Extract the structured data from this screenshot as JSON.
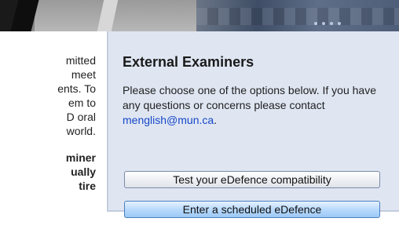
{
  "left_column": {
    "lines": [
      "mitted",
      "meet",
      "ents.  To",
      "em to",
      "D oral",
      "world."
    ],
    "bold_lines": [
      "miner",
      "ually",
      "tire"
    ]
  },
  "panel": {
    "title": "External Examiners",
    "body_text": "Please choose one of the options below.  If you have any questions or concerns please contact",
    "email": "menglish@mun.ca",
    "email_suffix": ".",
    "buttons": {
      "test_label": "Test your eDefence compatibility",
      "enter_label": "Enter a scheduled eDefence"
    }
  },
  "colors": {
    "panel_bg": "#dfe6f2",
    "link": "#1747c7",
    "enter_button": "#b9dafc"
  }
}
